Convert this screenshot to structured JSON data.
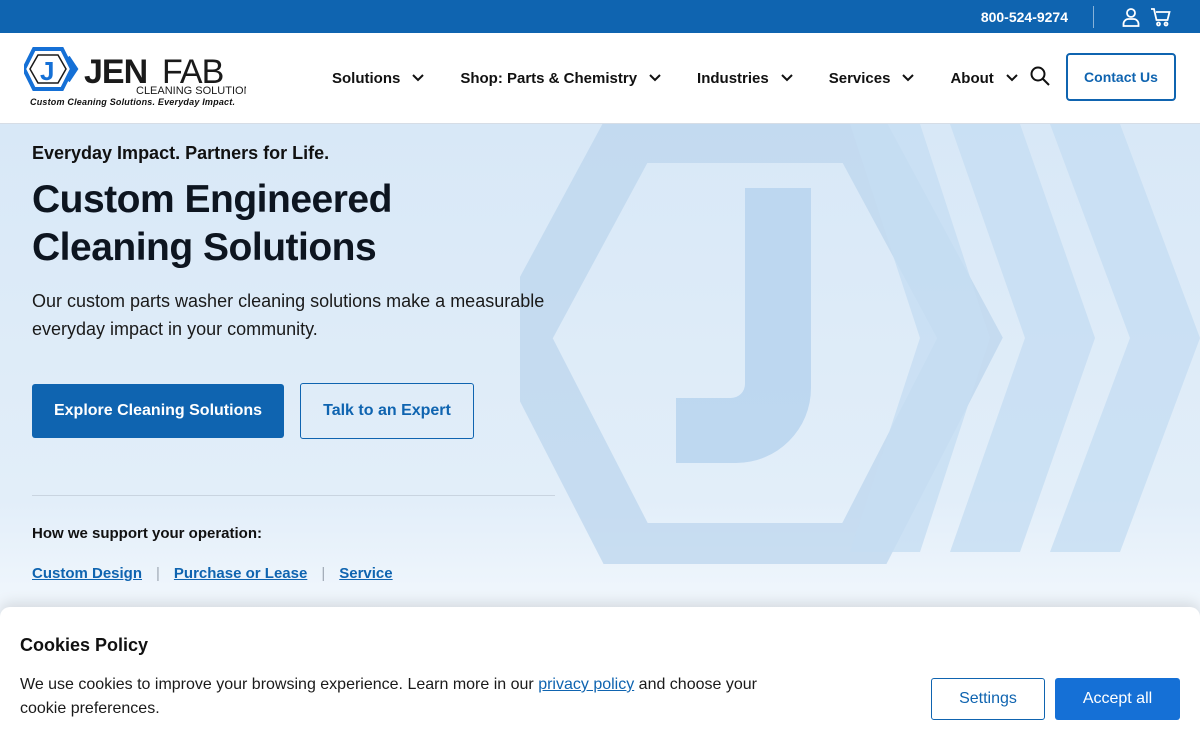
{
  "topbar": {
    "phone": "800-524-9274",
    "account_icon": "user-icon",
    "cart_icon": "cart-icon"
  },
  "logo": {
    "name_part1": "JEN",
    "name_part2": "FAB",
    "subtitle": "CLEANING SOLUTIONS",
    "tagline": "Custom Cleaning Solutions. Everyday Impact."
  },
  "nav": {
    "items": [
      {
        "label": "Solutions"
      },
      {
        "label": "Shop: Parts & Chemistry"
      },
      {
        "label": "Industries"
      },
      {
        "label": "Services"
      },
      {
        "label": "About"
      }
    ],
    "search_icon": "search-icon",
    "contact_label": "Contact Us"
  },
  "hero": {
    "eyebrow": "Everyday Impact. Partners for Life.",
    "headline": "Custom Engineered Cleaning Solutions",
    "lede": "Our custom parts washer cleaning solutions make a measurable everyday impact in your community.",
    "primary_cta": "Explore Cleaning Solutions",
    "secondary_cta": "Talk to an Expert",
    "support_label": "How we support your operation:",
    "support_links": [
      "Custom Design",
      "Purchase or Lease",
      "Service"
    ]
  },
  "cookie": {
    "title": "Cookies Policy",
    "text_before": "We use cookies to improve your browsing experience. Learn more in our ",
    "link_text": "privacy policy",
    "text_after": " and choose your cookie preferences.",
    "settings_label": "Settings",
    "accept_label": "Accept all"
  },
  "colors": {
    "brand_blue": "#0f64b0",
    "accept_blue": "#1570d6",
    "hero_bg": "#d8e8f7"
  }
}
